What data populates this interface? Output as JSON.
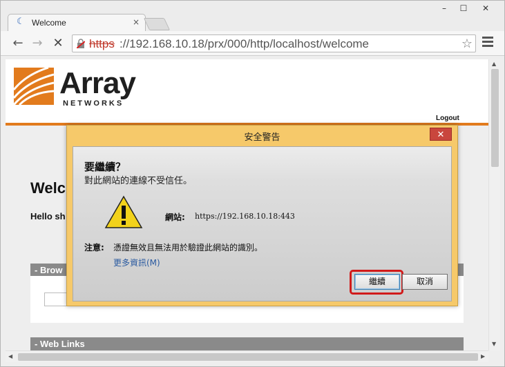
{
  "browser": {
    "tab_title": "Welcome",
    "tab_close": "×",
    "window_min": "–",
    "window_max": "☐",
    "window_close": "✕",
    "url_scheme": "https",
    "url_rest": "://192.168.10.18/prx/000/http/localhost/welcome",
    "back": "←",
    "forward": "→",
    "stop": "✕",
    "star": "☆"
  },
  "page": {
    "logo_text": "Array",
    "logo_sub": "NETWORKS",
    "logout": "Logout",
    "welcome_heading": "Welc",
    "hello_text": "Hello sh",
    "section_browse": "- Brow",
    "section_weblinks": "- Web Links"
  },
  "dialog": {
    "title": "安全警告",
    "close": "✕",
    "heading": "要繼續？",
    "subheading": "對此網站的連線不受信任。",
    "site_label": "網站:",
    "site_value": "https://192.168.10.18:443",
    "note_label": "注意:",
    "note_text": "憑證無效且無法用於驗證此網站的識別。",
    "more_info": "更多資訊(M)",
    "continue_label": "繼續",
    "cancel_label": "取消"
  },
  "colors": {
    "accent_orange": "#e27b1d",
    "dialog_frame": "#f6c96a",
    "highlight_red": "#d11a1a",
    "link_blue": "#2a5aa0"
  }
}
